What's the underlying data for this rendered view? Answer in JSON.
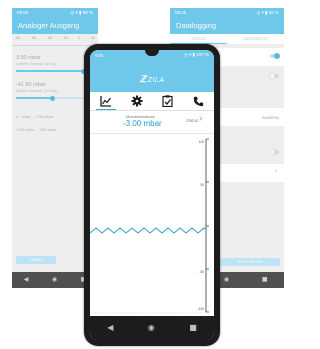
{
  "left_screen": {
    "status_time": "09:55",
    "status_icons": "◎ ▾ ▮ 98 %",
    "title": "Analoger Ausgang",
    "scale_ticks": [
      "-00",
      "-60",
      "-40",
      "-20",
      "0",
      "20"
    ],
    "output1_value": "3.90 mbar",
    "output1_label": "Unterer Grenzw. (4 mA)",
    "output2_value": "-41.80 mbar",
    "output2_label": "Oberer Grenzw. (20 mA)",
    "range1": "0 . mbar ... 100 mbar",
    "range2": "-100 mbar ... 100 mbar",
    "button_label": "LESEN"
  },
  "right_screen": {
    "status_time": "09:35",
    "status_icons": "◎ ▾ ▮ 98 %",
    "title": "Datalogging",
    "tab_status": "STATUS",
    "tab_data": "DATENSÄTZE",
    "change_label": "ÄNDERN",
    "start_label": "SES STARTEN"
  },
  "front_screen": {
    "status_time": "9:51",
    "status_icons": "◎ ▾ ▮ 100 %",
    "logo": "ZILA",
    "measure_label": "Momentandruck",
    "measure_value": "-3.00 mbar",
    "status_label": "Status",
    "axis_labels": [
      "100",
      "50",
      "0",
      "-50",
      "-100"
    ]
  },
  "colors": {
    "accent": "#6fc7ea",
    "accent_dark": "#2a9bd0",
    "nav": "#505050"
  }
}
